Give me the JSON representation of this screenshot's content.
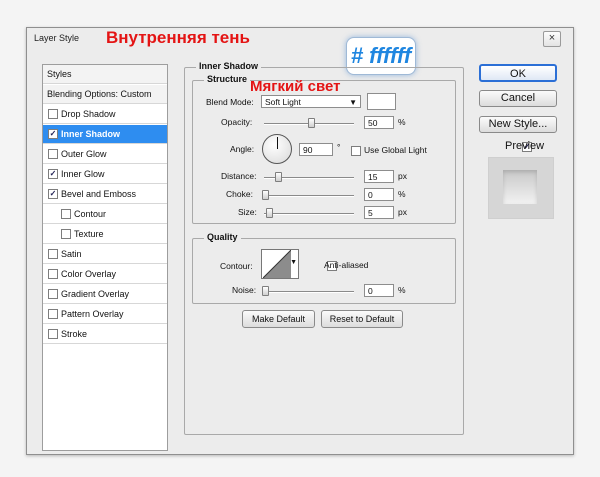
{
  "window": {
    "title": "Layer Style",
    "close_glyph": "×"
  },
  "annotations": {
    "heading": "Внутренняя тень",
    "blend_note": "Мягкий свет",
    "color_code": "# ffffff",
    "color_code_color": "#1f86e0",
    "annotation_color": "#e41414"
  },
  "sidebar": {
    "header": "Styles",
    "blending": "Blending Options: Custom",
    "items": [
      {
        "label": "Drop Shadow",
        "checked": false
      },
      {
        "label": "Inner Shadow",
        "checked": true,
        "selected": true
      },
      {
        "label": "Outer Glow",
        "checked": false
      },
      {
        "label": "Inner Glow",
        "checked": true
      },
      {
        "label": "Bevel and Emboss",
        "checked": true
      },
      {
        "label": "Contour",
        "checked": false,
        "indent": true
      },
      {
        "label": "Texture",
        "checked": false,
        "indent": true
      },
      {
        "label": "Satin",
        "checked": false
      },
      {
        "label": "Color Overlay",
        "checked": false
      },
      {
        "label": "Gradient Overlay",
        "checked": false
      },
      {
        "label": "Pattern Overlay",
        "checked": false
      },
      {
        "label": "Stroke",
        "checked": false
      }
    ]
  },
  "inner_shadow": {
    "title": "Inner Shadow",
    "structure": {
      "title": "Structure",
      "blend_mode_label": "Blend Mode:",
      "blend_mode_value": "Soft Light",
      "blend_color": "#ffffff",
      "opacity_label": "Opacity:",
      "opacity_value": "50",
      "opacity_unit": "%",
      "opacity_level": 0.5,
      "angle_label": "Angle:",
      "angle_value": "90",
      "angle_unit": "°",
      "use_global_light_label": "Use Global Light",
      "use_global_light": false,
      "distance_label": "Distance:",
      "distance_value": "15",
      "distance_unit": "px",
      "choke_label": "Choke:",
      "choke_value": "0",
      "choke_unit": "%",
      "size_label": "Size:",
      "size_value": "5",
      "size_unit": "px"
    },
    "quality": {
      "title": "Quality",
      "contour_label": "Contour:",
      "anti_aliased_label": "Anti-aliased",
      "anti_aliased": false,
      "noise_label": "Noise:",
      "noise_value": "0",
      "noise_unit": "%"
    },
    "make_default": "Make Default",
    "reset_default": "Reset to Default"
  },
  "buttons": {
    "ok": "OK",
    "cancel": "Cancel",
    "new_style": "New Style...",
    "preview": "Preview",
    "preview_checked": true
  },
  "colors": {
    "selection": "#2e8df0",
    "ok_border": "#2b6fd6"
  }
}
